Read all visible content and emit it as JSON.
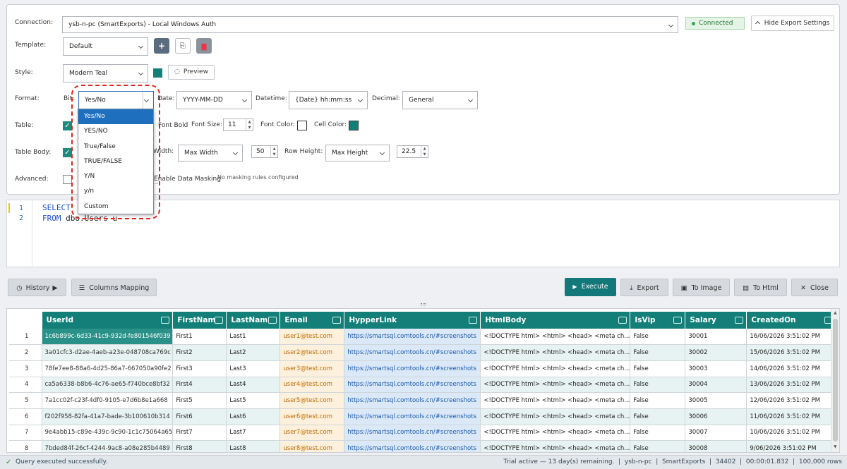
{
  "connection": {
    "label": "Connection:",
    "value": "ysb-n-pc (SmartExports) - Local Windows Auth",
    "status": "Connected",
    "hide_button": "Hide Export Settings"
  },
  "template": {
    "label": "Template:",
    "value": "Default"
  },
  "style": {
    "label": "Style:",
    "value": "Modern Teal",
    "preview_button": "Preview",
    "swatch_color": "#138077"
  },
  "format": {
    "label": "Format:",
    "bit_label": "Bit:",
    "bit_value": "Yes/No",
    "date_label": "Date:",
    "date_value": "YYYY-MM-DD",
    "datetime_label": "Datetime:",
    "datetime_value": "{Date} hh:mm:ss",
    "decimal_label": "Decimal:",
    "decimal_value": "General",
    "bit_options": [
      "Yes/No",
      "YES/NO",
      "True/False",
      "TRUE/FALSE",
      "Y/N",
      "y/n",
      "Custom"
    ],
    "bit_selected": "Yes/No"
  },
  "table": {
    "label": "Table:",
    "header_bold_label": "Font Bold",
    "font_size_label": "Font Size:",
    "font_size": "11",
    "font_color_label": "Font Color:",
    "cell_color_label": "Cell Color:",
    "cell_color": "#138077"
  },
  "table_body": {
    "label": "Table Body:",
    "col_width_label": "Width:",
    "col_width_mode": "Max Width",
    "col_width": "50",
    "row_height_label": "Row Height:",
    "row_height_mode": "Max Height",
    "row_height": "22.5"
  },
  "advanced": {
    "label": "Advanced:",
    "masking_label": "Enable Data Masking",
    "masking_status": "No masking rules configured"
  },
  "editor": {
    "line1_kw": "SELECT",
    "line1_rest": "",
    "line2_kw": "FROM",
    "line2_rest": "dbo.Users u"
  },
  "toolbar": {
    "history": "History",
    "columns_mapping": "Columns Mapping",
    "execute": "Execute",
    "export": "Export",
    "to_image": "To Image",
    "to_html": "To Html",
    "close": "Close"
  },
  "grid": {
    "columns": [
      "UserId",
      "FirstNam",
      "LastNam",
      "Email",
      "HypperLink",
      "HtmlBody",
      "IsVip",
      "Salary",
      "CreatedOn"
    ],
    "rows": [
      [
        "1",
        "1c6b899c-6d33-41c9-932d-fe801546f039",
        "First1",
        "Last1",
        "user1@test.com",
        "https://smartsql.comtools.cn/#screenshots",
        "<!DOCTYPE html> <html> <head>    <meta ch...",
        "False",
        "30001",
        "16/06/2026 3:51:02 PM"
      ],
      [
        "2",
        "3a01cfc3-d2ae-4aeb-a23e-048708ca769c",
        "First2",
        "Last2",
        "user2@test.com",
        "https://smartsql.comtools.cn/#screenshots",
        "<!DOCTYPE html> <html> <head>    <meta ch...",
        "False",
        "30002",
        "15/06/2026 3:51:02 PM"
      ],
      [
        "3",
        "78fe7ee8-88a6-4d25-86a7-667050a90fe2",
        "First3",
        "Last3",
        "user3@test.com",
        "https://smartsql.comtools.cn/#screenshots",
        "<!DOCTYPE html> <html> <head>    <meta ch...",
        "False",
        "30003",
        "14/06/2026 3:51:02 PM"
      ],
      [
        "4",
        "ca5a6338-b8b6-4c76-ae65-f740bce8bf32",
        "First4",
        "Last4",
        "user4@test.com",
        "https://smartsql.comtools.cn/#screenshots",
        "<!DOCTYPE html> <html> <head>    <meta ch...",
        "False",
        "30004",
        "13/06/2026 3:51:02 PM"
      ],
      [
        "5",
        "7a1cc02f-c23f-4df0-9105-e7d6b8e1a668",
        "First5",
        "Last5",
        "user5@test.com",
        "https://smartsql.comtools.cn/#screenshots",
        "<!DOCTYPE html> <html> <head>    <meta ch...",
        "False",
        "30005",
        "12/06/2026 3:51:02 PM"
      ],
      [
        "6",
        "f202f958-82fa-41a7-bade-3b100610b314",
        "First6",
        "Last6",
        "user6@test.com",
        "https://smartsql.comtools.cn/#screenshots",
        "<!DOCTYPE html> <html> <head>    <meta ch...",
        "False",
        "30006",
        "11/06/2026 3:51:02 PM"
      ],
      [
        "7",
        "9e4abb15-c89e-439c-9c90-1c1c75064a65",
        "First7",
        "Last7",
        "user7@test.com",
        "https://smartsql.comtools.cn/#screenshots",
        "<!DOCTYPE html> <html> <head>    <meta ch...",
        "False",
        "30007",
        "10/06/2026 3:51:02 PM"
      ],
      [
        "8",
        "7bded84f-26cf-4244-9ac8-a08e285b4489",
        "First8",
        "Last8",
        "user8@test.com",
        "https://smartsql.comtools.cn/#screenshots",
        "<!DOCTYPE html> <html> <head>    <meta ch...",
        "False",
        "30008",
        "9/06/2026 3:51:02 PM"
      ]
    ]
  },
  "status": {
    "message": "Query executed successfully.",
    "right": "Trial active — 13 day(s) remaining.  |  ysb-n-pc  |  SmartExports  |  34402  |  00:00:01.832  |  100,000 rows"
  }
}
